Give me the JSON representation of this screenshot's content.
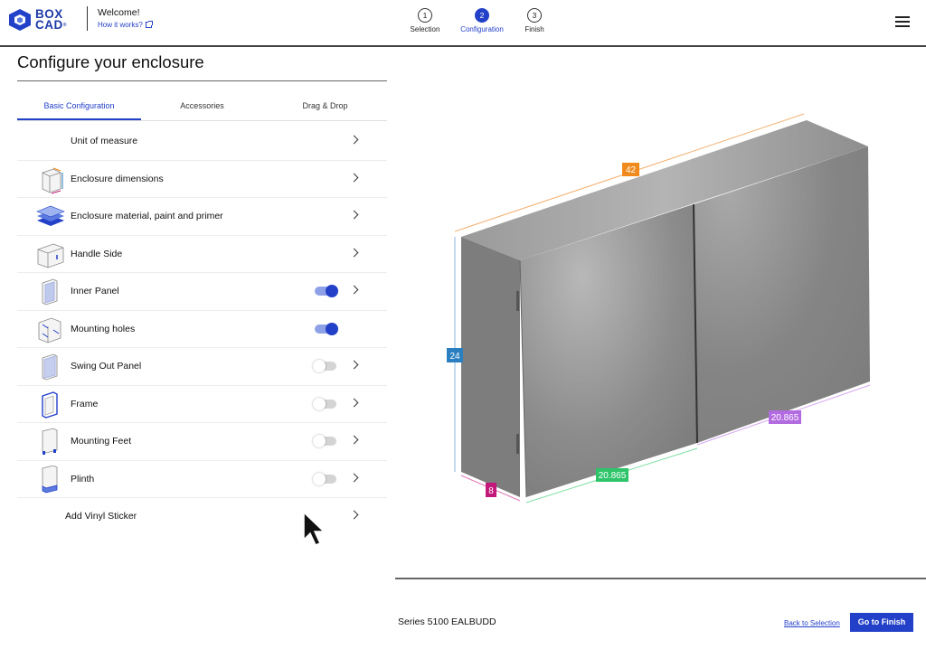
{
  "header": {
    "logo_line1": "BOX",
    "logo_line2": "CAD",
    "logo_reg": "®",
    "welcome": "Welcome!",
    "how_link": "How it works?",
    "steps": [
      {
        "number": "1",
        "label": "Selection",
        "state": "done"
      },
      {
        "number": "2",
        "label": "Configuration",
        "state": "active"
      },
      {
        "number": "3",
        "label": "Finish",
        "state": "pending"
      }
    ],
    "menu_icon": "hamburger-menu-icon"
  },
  "page": {
    "title": "Configure your enclosure"
  },
  "tabs": [
    {
      "label": "Basic Configuration",
      "active": true
    },
    {
      "label": "Accessories",
      "active": false
    },
    {
      "label": "Drag & Drop",
      "active": false
    }
  ],
  "options": [
    {
      "label": "Unit of measure",
      "icon": null,
      "toggle": null
    },
    {
      "label": "Enclosure dimensions",
      "icon": "enclosure-dimensions-icon",
      "toggle": null
    },
    {
      "label": "Enclosure material, paint and primer",
      "icon": "material-layers-icon",
      "toggle": null
    },
    {
      "label": "Handle Side",
      "icon": "handle-side-icon",
      "toggle": null
    },
    {
      "label": "Inner Panel",
      "icon": "inner-panel-icon",
      "toggle": true
    },
    {
      "label": "Mounting holes",
      "icon": "mounting-holes-icon",
      "toggle": true
    },
    {
      "label": "Swing Out Panel",
      "icon": "swing-out-panel-icon",
      "toggle": false
    },
    {
      "label": "Frame",
      "icon": "frame-icon",
      "toggle": false
    },
    {
      "label": "Mounting Feet",
      "icon": "mounting-feet-icon",
      "toggle": false
    },
    {
      "label": "Plinth",
      "icon": "plinth-icon",
      "toggle": false
    },
    {
      "label": "Add Vinyl Sticker",
      "icon": null,
      "toggle": null
    }
  ],
  "model": {
    "width": "42",
    "height": "24",
    "depth": "8",
    "door_width_left": "20.865",
    "door_width_right": "20.865",
    "colors": {
      "width": "#f08a1c",
      "height": "#2a7fc0",
      "depth": "#c2187a",
      "door_left": "#2ec46a",
      "door_right": "#b36be0"
    }
  },
  "footer": {
    "series": "Series 5100 EALBUDD",
    "back_link": "Back to Selection",
    "finish_button": "Go to Finish"
  },
  "colors": {
    "accent": "#2340c8"
  }
}
